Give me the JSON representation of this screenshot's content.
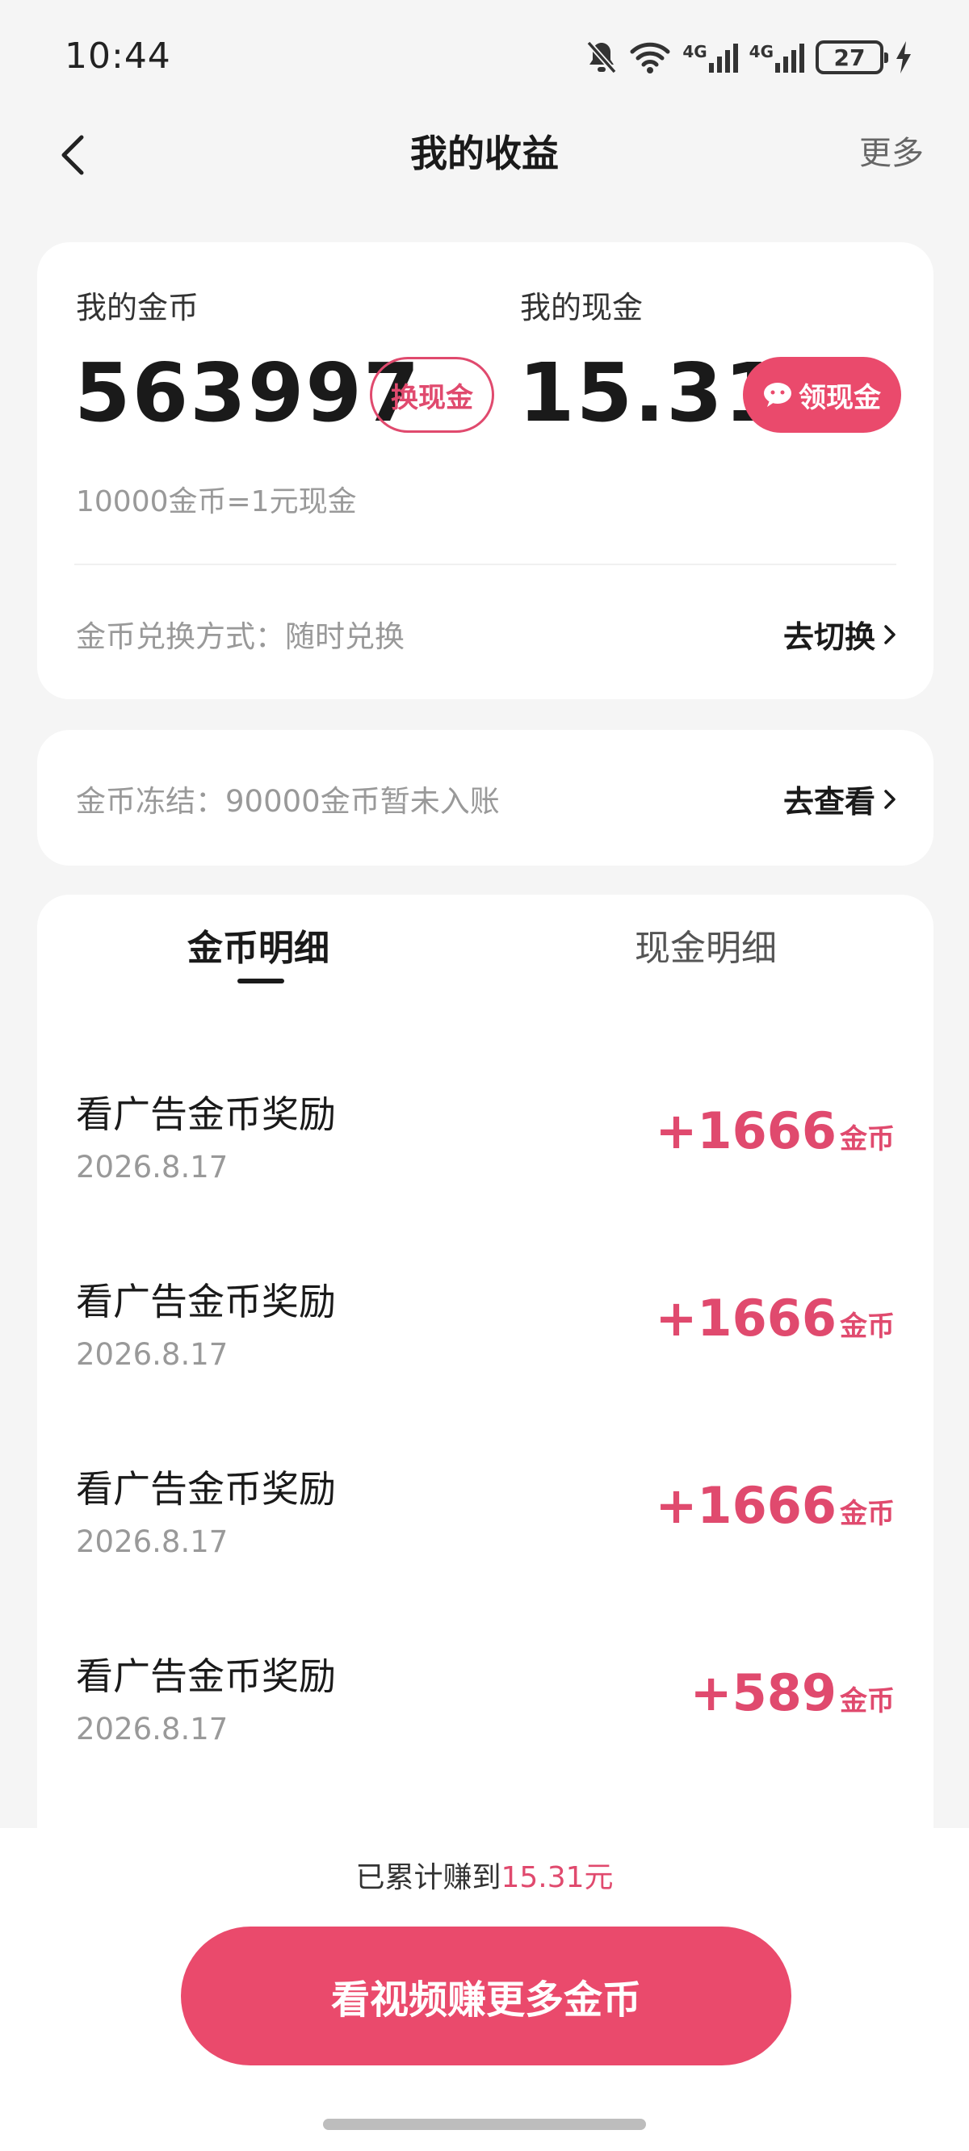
{
  "status_bar": {
    "time": "10:44",
    "battery": "27",
    "network_1": "4G",
    "network_2": "4G"
  },
  "header": {
    "title": "我的收益",
    "more": "更多"
  },
  "summary": {
    "coin_label": "我的金币",
    "coin_value": "563997",
    "exchange_button": "换现金",
    "cash_label": "我的现金",
    "cash_value": "15.31",
    "withdraw_button": "领现金",
    "rate": "10000金币=1元现金",
    "exchange_mode": "金币兑换方式：随时兑换",
    "switch_link": "去切换"
  },
  "freeze": {
    "text": "金币冻结：90000金币暂未入账",
    "link": "去查看"
  },
  "tabs": [
    {
      "label": "金币明细",
      "active": true
    },
    {
      "label": "现金明细",
      "active": false
    }
  ],
  "records": [
    {
      "title": "看广告金币奖励",
      "date": "2026.8.17",
      "amount": "+1666",
      "unit": "金币"
    },
    {
      "title": "看广告金币奖励",
      "date": "2026.8.17",
      "amount": "+1666",
      "unit": "金币"
    },
    {
      "title": "看广告金币奖励",
      "date": "2026.8.17",
      "amount": "+1666",
      "unit": "金币"
    },
    {
      "title": "看广告金币奖励",
      "date": "2026.8.17",
      "amount": "+589",
      "unit": "金币"
    }
  ],
  "footer": {
    "earned_prefix": "已累计赚到",
    "earned_value": "15.31元",
    "cta": "看视频赚更多金币"
  },
  "colors": {
    "accent": "#ea4a6c",
    "accent_text": "#e04a6e",
    "background": "#f5f5f5"
  }
}
